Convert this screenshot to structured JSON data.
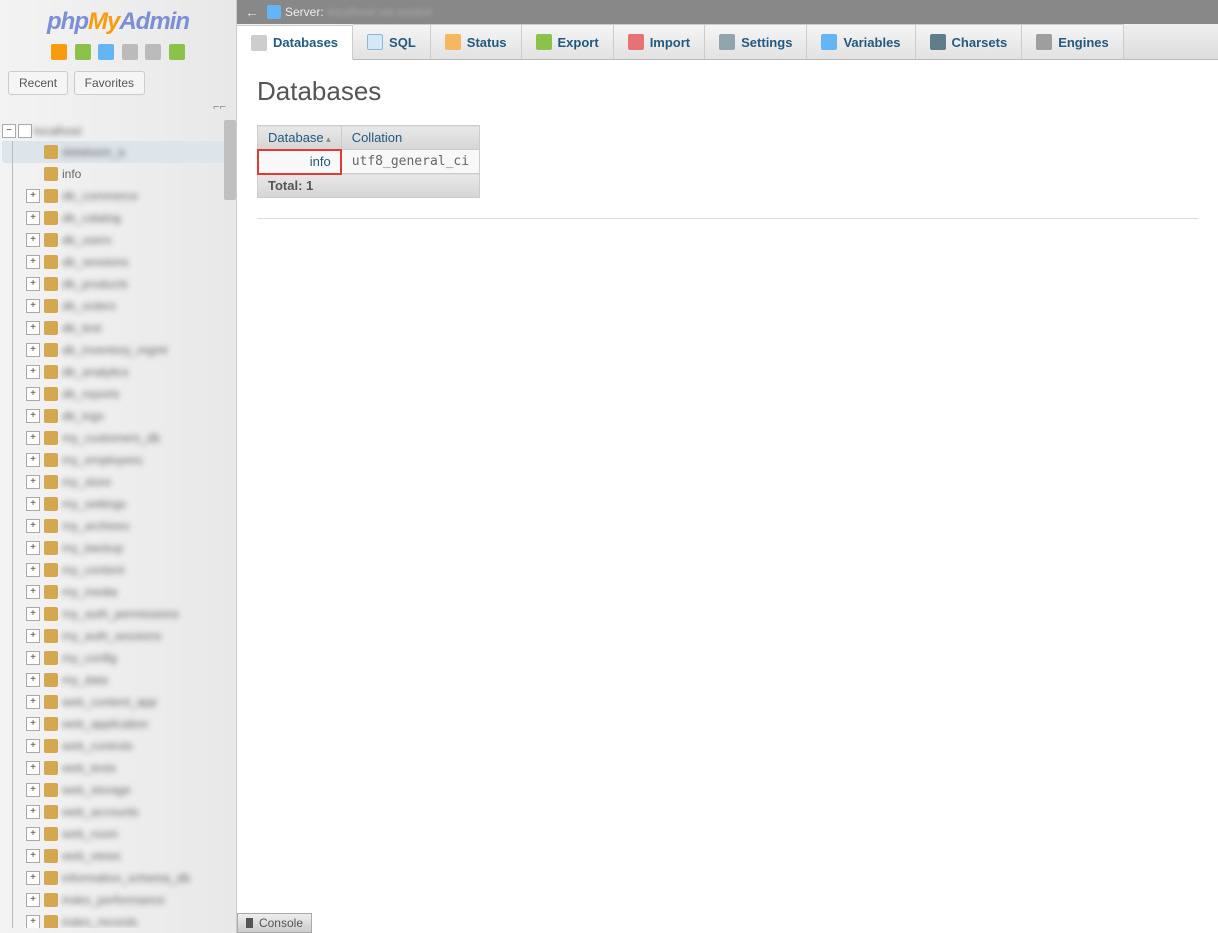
{
  "logo": {
    "php": "php",
    "my": "My",
    "admin": "Admin"
  },
  "sidebar": {
    "recent": "Recent",
    "favorites": "Favorites",
    "link_hint": "⌐⌐",
    "root_label": "localhost",
    "items": [
      {
        "label": "database_a",
        "highlighted": true,
        "expand": false
      },
      {
        "label": "info",
        "info": true,
        "expand": false
      },
      {
        "label": "db_commerce",
        "expand": true
      },
      {
        "label": "db_catalog",
        "expand": true
      },
      {
        "label": "db_users",
        "expand": true
      },
      {
        "label": "db_sessions",
        "expand": true
      },
      {
        "label": "db_products",
        "expand": true
      },
      {
        "label": "db_orders",
        "expand": true
      },
      {
        "label": "db_test",
        "expand": true
      },
      {
        "label": "db_inventory_mgmt",
        "expand": true
      },
      {
        "label": "db_analytics",
        "expand": true
      },
      {
        "label": "db_reports",
        "expand": true
      },
      {
        "label": "db_logs",
        "expand": true
      },
      {
        "label": "my_customers_db",
        "expand": true
      },
      {
        "label": "my_employees",
        "expand": true
      },
      {
        "label": "my_store",
        "expand": true
      },
      {
        "label": "my_settings",
        "expand": true
      },
      {
        "label": "my_archives",
        "expand": true
      },
      {
        "label": "my_backup",
        "expand": true
      },
      {
        "label": "my_content",
        "expand": true
      },
      {
        "label": "my_media",
        "expand": true
      },
      {
        "label": "my_auth_permissions",
        "expand": true
      },
      {
        "label": "my_auth_sessions",
        "expand": true
      },
      {
        "label": "my_config",
        "expand": true
      },
      {
        "label": "my_data",
        "expand": true
      },
      {
        "label": "web_content_app",
        "expand": true
      },
      {
        "label": "web_application",
        "expand": true
      },
      {
        "label": "web_controls",
        "expand": true
      },
      {
        "label": "web_tests",
        "expand": true
      },
      {
        "label": "web_storage",
        "expand": true
      },
      {
        "label": "web_accounts",
        "expand": true
      },
      {
        "label": "web_room",
        "expand": true
      },
      {
        "label": "web_views",
        "expand": true
      },
      {
        "label": "information_schema_db",
        "expand": true
      },
      {
        "label": "index_performance",
        "expand": true
      },
      {
        "label": "index_records",
        "expand": true
      }
    ]
  },
  "topbar": {
    "server_label": "Server:",
    "server_name": "localhost via socket"
  },
  "tabs": [
    {
      "label": "Databases",
      "icon": "db",
      "active": true
    },
    {
      "label": "SQL",
      "icon": "sql"
    },
    {
      "label": "Status",
      "icon": "status"
    },
    {
      "label": "Export",
      "icon": "export"
    },
    {
      "label": "Import",
      "icon": "import"
    },
    {
      "label": "Settings",
      "icon": "settings"
    },
    {
      "label": "Variables",
      "icon": "vars"
    },
    {
      "label": "Charsets",
      "icon": "charsets"
    },
    {
      "label": "Engines",
      "icon": "engines"
    }
  ],
  "page": {
    "title": "Databases",
    "table": {
      "headers": {
        "database": "Database",
        "collation": "Collation"
      },
      "rows": [
        {
          "name": "info",
          "collation": "utf8_general_ci",
          "highlighted": true
        }
      ],
      "footer": "Total: 1"
    }
  },
  "console": {
    "label": "Console"
  }
}
